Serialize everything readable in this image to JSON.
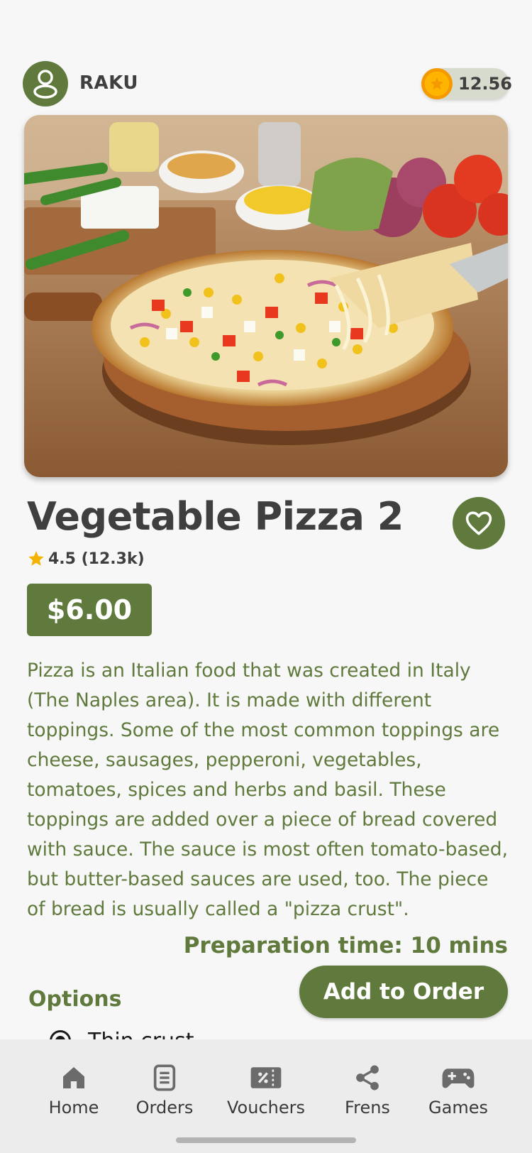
{
  "header": {
    "username": "RAKU",
    "coin_balance": "12.56"
  },
  "product": {
    "title": "Vegetable Pizza 2",
    "rating": "4.5 (12.3k)",
    "price": "$6.00",
    "description": "Pizza is an Italian food that was created in Italy (The Naples area). It is made with different toppings. Some of the most common toppings are cheese, sausages, pepperoni, vegetables, tomatoes, spices and herbs and basil. These toppings are added over a piece of bread covered with sauce. The sauce is most often tomato-based, but butter-based sauces are used, too. The piece of bread is usually called a \"pizza crust\".",
    "prep_time": "Preparation time: 10 mins"
  },
  "order": {
    "add_label": "Add to Order"
  },
  "options": {
    "label": "Options",
    "items": [
      {
        "label": "Thin crust",
        "selected": true
      }
    ]
  },
  "nav": {
    "items": [
      {
        "label": "Home",
        "icon": "home-icon"
      },
      {
        "label": "Orders",
        "icon": "orders-icon"
      },
      {
        "label": "Vouchers",
        "icon": "vouchers-icon"
      },
      {
        "label": "Frens",
        "icon": "share-icon"
      },
      {
        "label": "Games",
        "icon": "gamepad-icon"
      }
    ]
  },
  "colors": {
    "primary": "#5f7a3c",
    "background": "#f7f7f7",
    "text_dark": "#3f3f3f",
    "nav_bg": "#ececec",
    "coin": "#ffb400",
    "star": "#f5b301"
  }
}
